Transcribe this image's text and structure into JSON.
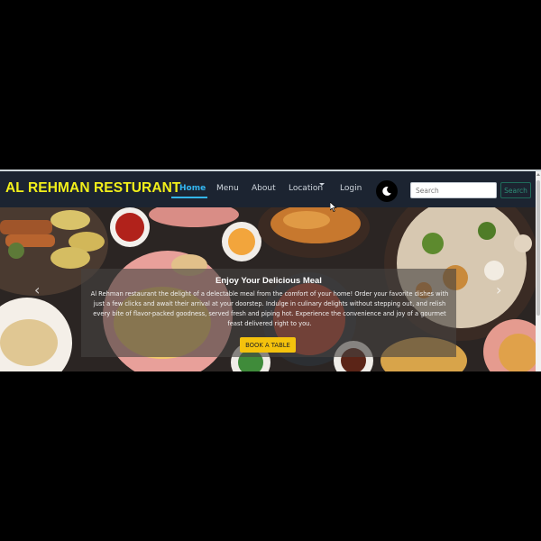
{
  "navbar": {
    "brand": "AL REHMAN RESTURANT",
    "links": [
      {
        "label": "Home",
        "active": true
      },
      {
        "label": "Menu"
      },
      {
        "label": "About"
      },
      {
        "label": "Location",
        "dropdown": true
      },
      {
        "label": "Login"
      }
    ],
    "theme_toggle_icon": "moon-icon",
    "search": {
      "placeholder": "Search",
      "value": "",
      "button_label": "Search"
    }
  },
  "hero": {
    "title": "Enjoy Your Delicious Meal",
    "text": "Al Rehman restaurant the delight of a delectable meal from the comfort of your home! Order your favorite dishes with just a few clicks and await their arrival at your doorstep. Indulge in culinary delights without stepping out, and relish every bite of flavor-packed goodness, served fresh and piping hot. Experience the convenience and joy of a gourmet feast delivered right to you.",
    "button_label": "BOOK A TABLE",
    "prev_icon": "chevron-left-icon",
    "next_icon": "chevron-right-icon"
  },
  "colors": {
    "navbar_bg": "#1c2431",
    "brand": "#f2ef1a",
    "active_link": "#33b6f0",
    "button": "#f4c20d",
    "search_button_border": "#1f6b5a"
  }
}
